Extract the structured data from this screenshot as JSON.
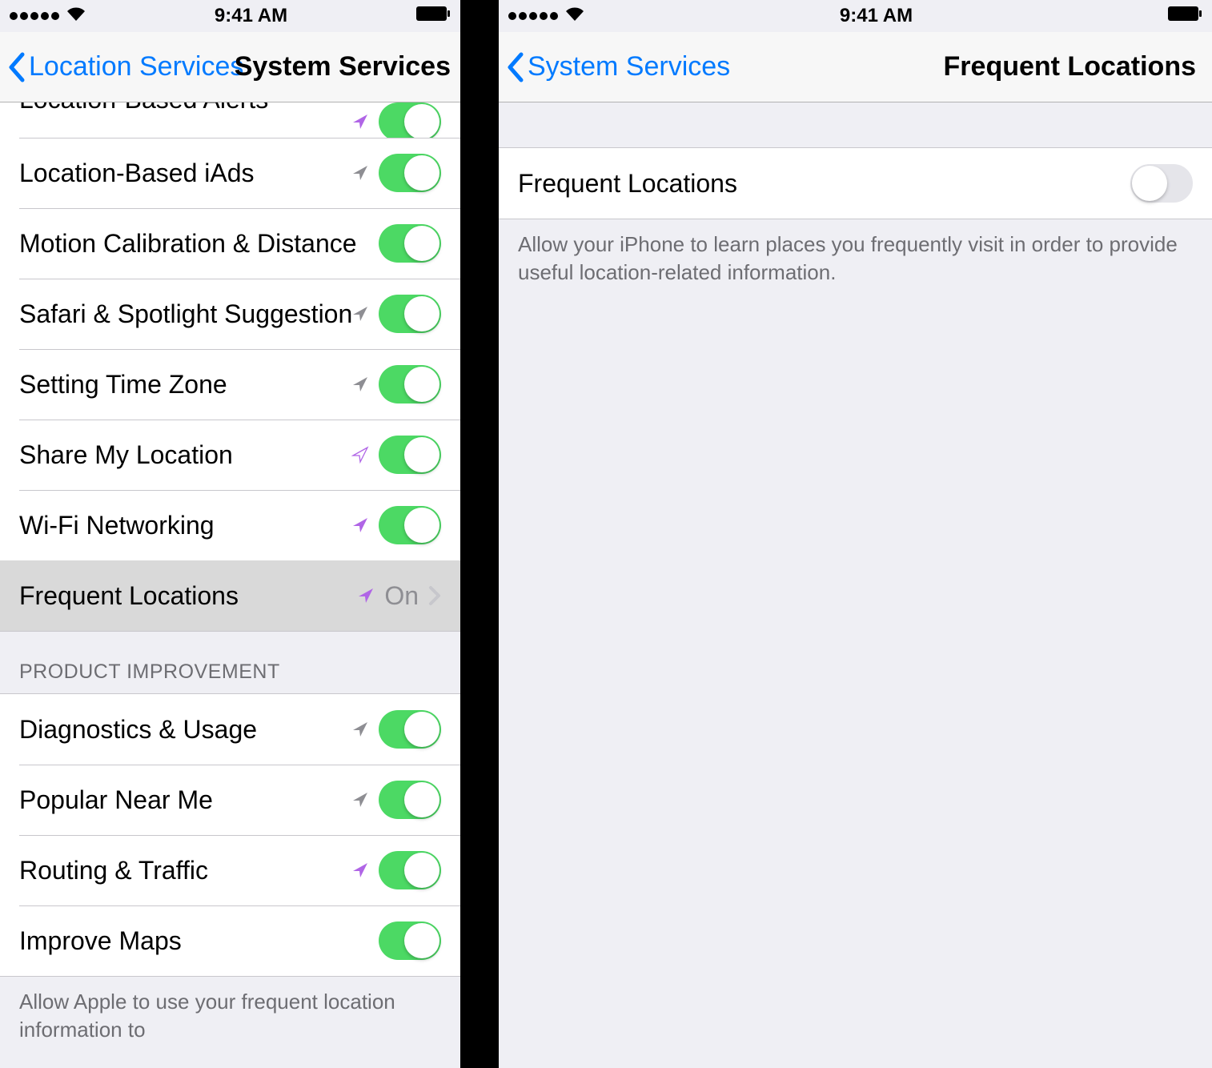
{
  "status": {
    "time": "9:41 AM"
  },
  "left": {
    "nav": {
      "back_label": "Location Services",
      "title": "System Services"
    },
    "rows_top": [
      {
        "label": "Location-Based Alerts",
        "icon": "purple",
        "toggle": true,
        "cutoff": true
      },
      {
        "label": "Location-Based iAds",
        "icon": "gray",
        "toggle": true
      },
      {
        "label": "Motion Calibration & Distance",
        "icon": "",
        "toggle": true
      },
      {
        "label": "Safari & Spotlight Suggestions",
        "icon": "gray",
        "toggle": true
      },
      {
        "label": "Setting Time Zone",
        "icon": "gray",
        "toggle": true
      },
      {
        "label": "Share My Location",
        "icon": "purple-outline",
        "toggle": true
      },
      {
        "label": "Wi-Fi Networking",
        "icon": "purple",
        "toggle": true
      }
    ],
    "frequent_row": {
      "label": "Frequent Locations",
      "icon": "purple",
      "value": "On"
    },
    "section2_header": "PRODUCT IMPROVEMENT",
    "rows_bottom": [
      {
        "label": "Diagnostics & Usage",
        "icon": "gray",
        "toggle": true
      },
      {
        "label": "Popular Near Me",
        "icon": "gray",
        "toggle": true
      },
      {
        "label": "Routing & Traffic",
        "icon": "purple",
        "toggle": true
      },
      {
        "label": "Improve Maps",
        "icon": "",
        "toggle": true
      }
    ],
    "footer": "Allow Apple to use your frequent location information to"
  },
  "right": {
    "nav": {
      "back_label": "System Services",
      "title": "Frequent Locations"
    },
    "row": {
      "label": "Frequent Locations",
      "toggle": false
    },
    "footer": "Allow your iPhone to learn places you frequently visit in order to provide useful location-related information."
  }
}
